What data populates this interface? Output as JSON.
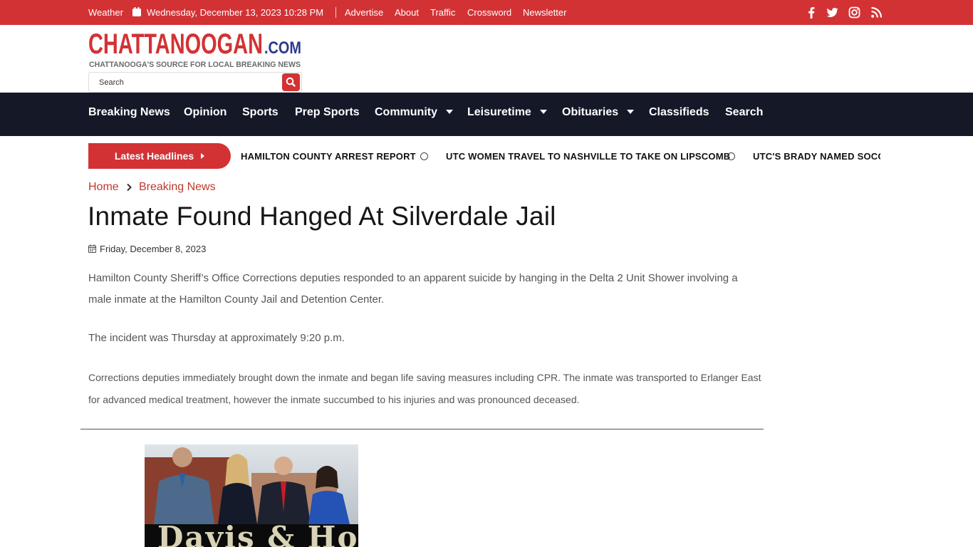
{
  "topbar": {
    "weather": "Weather",
    "datetime": "Wednesday, December 13, 2023 10:28 PM",
    "links": [
      "Advertise",
      "About",
      "Traffic",
      "Crossword",
      "Newsletter"
    ]
  },
  "header": {
    "logo_main": "CHATTANOOGAN",
    "logo_suffix": ".COM",
    "tagline": "CHATTANOOGA'S SOURCE FOR LOCAL BREAKING NEWS",
    "search_placeholder": "Search"
  },
  "nav": {
    "items": [
      "Breaking News",
      "Opinion",
      "Sports",
      "Prep Sports",
      "Community",
      "Leisuretime",
      "Obituaries",
      "Classifieds",
      "Search"
    ]
  },
  "ticker": {
    "label": "Latest Headlines",
    "items": [
      "HAMILTON COUNTY ARREST REPORT",
      "UTC WOMEN TRAVEL TO NASHVILLE TO TAKE ON LIPSCOMB",
      "UTC'S BRADY NAMED SOCON"
    ]
  },
  "breadcrumb": {
    "home": "Home",
    "section": "Breaking News"
  },
  "article": {
    "title": "Inmate Found Hanged At Silverdale Jail",
    "date": "Friday, December 8, 2023",
    "paragraphs": [
      "Hamilton County Sheriff’s Office Corrections deputies responded to an apparent suicide by hanging in the Delta 2 Unit Shower involving a male inmate at the Hamilton County Jail and Detention Center.",
      "The incident was Thursday at approximately 9:20 p.m.",
      "Corrections deputies immediately brought down the inmate and began life saving measures including CPR. The inmate was transported to Erlanger East for advanced medical treatment, however the inmate succumbed to his injuries and was pronounced deceased."
    ]
  },
  "ad": {
    "text": "Davis & Hoss"
  },
  "colors": {
    "brand_red": "#d33234",
    "nav_bg": "#141827",
    "logo_blue": "#2b3990"
  }
}
